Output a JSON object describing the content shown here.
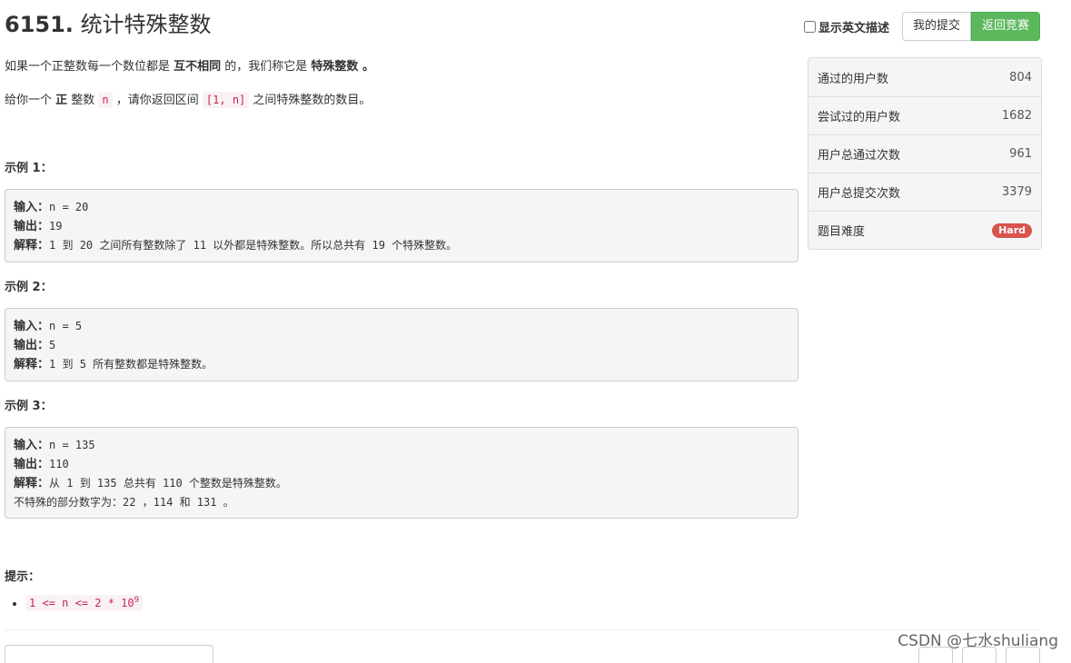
{
  "problem": {
    "number": "6151.",
    "title": "统计特殊整数"
  },
  "topbar": {
    "english_toggle_label": "显示英文描述",
    "my_submissions_label": "我的提交",
    "back_to_contest_label": "返回竞赛"
  },
  "description": {
    "p1_pre": "如果一个正整数每一个数位都是 ",
    "p1_bold": "互不相同",
    "p1_mid": " 的，我们称它是 ",
    "p1_bold2": "特殊整数",
    "p1_end": " 。",
    "p2_pre": "给你一个 ",
    "p2_bold": "正",
    "p2_mid": " 整数 ",
    "p2_code1": "n",
    "p2_mid2": " ，请你返回区间 ",
    "p2_code2": "[1, n]",
    "p2_end": " 之间特殊整数的数目。"
  },
  "examples": [
    {
      "title": "示例 1：",
      "input_label": "输入：",
      "input": "n = 20",
      "output_label": "输出：",
      "output": "19",
      "explain_label": "解释：",
      "explain": "1 到 20 之间所有整数除了 11 以外都是特殊整数。所以总共有 19 个特殊整数。",
      "extra": ""
    },
    {
      "title": "示例 2：",
      "input_label": "输入：",
      "input": "n = 5",
      "output_label": "输出：",
      "output": "5",
      "explain_label": "解释：",
      "explain": "1 到 5 所有整数都是特殊整数。",
      "extra": ""
    },
    {
      "title": "示例 3：",
      "input_label": "输入：",
      "input": "n = 135",
      "output_label": "输出：",
      "output": "110",
      "explain_label": "解释：",
      "explain": "从 1 到 135 总共有 110 个整数是特殊整数。",
      "extra": "不特殊的部分数字为：22 ，114 和 131 。"
    }
  ],
  "hints": {
    "title": "提示：",
    "items": [
      {
        "base": "1 <= n <= 2 * 10",
        "sup": "9"
      }
    ]
  },
  "stats": [
    {
      "label": "通过的用户数",
      "value": "804"
    },
    {
      "label": "尝试过的用户数",
      "value": "1682"
    },
    {
      "label": "用户总通过次数",
      "value": "961"
    },
    {
      "label": "用户总提交次数",
      "value": "3379"
    },
    {
      "label": "题目难度",
      "value": "Hard"
    }
  ],
  "colors": {
    "success_button": "#5cb85c",
    "hard_badge": "#d9534f",
    "code_text": "#c7254e"
  },
  "watermark": "CSDN @七水shuliang"
}
